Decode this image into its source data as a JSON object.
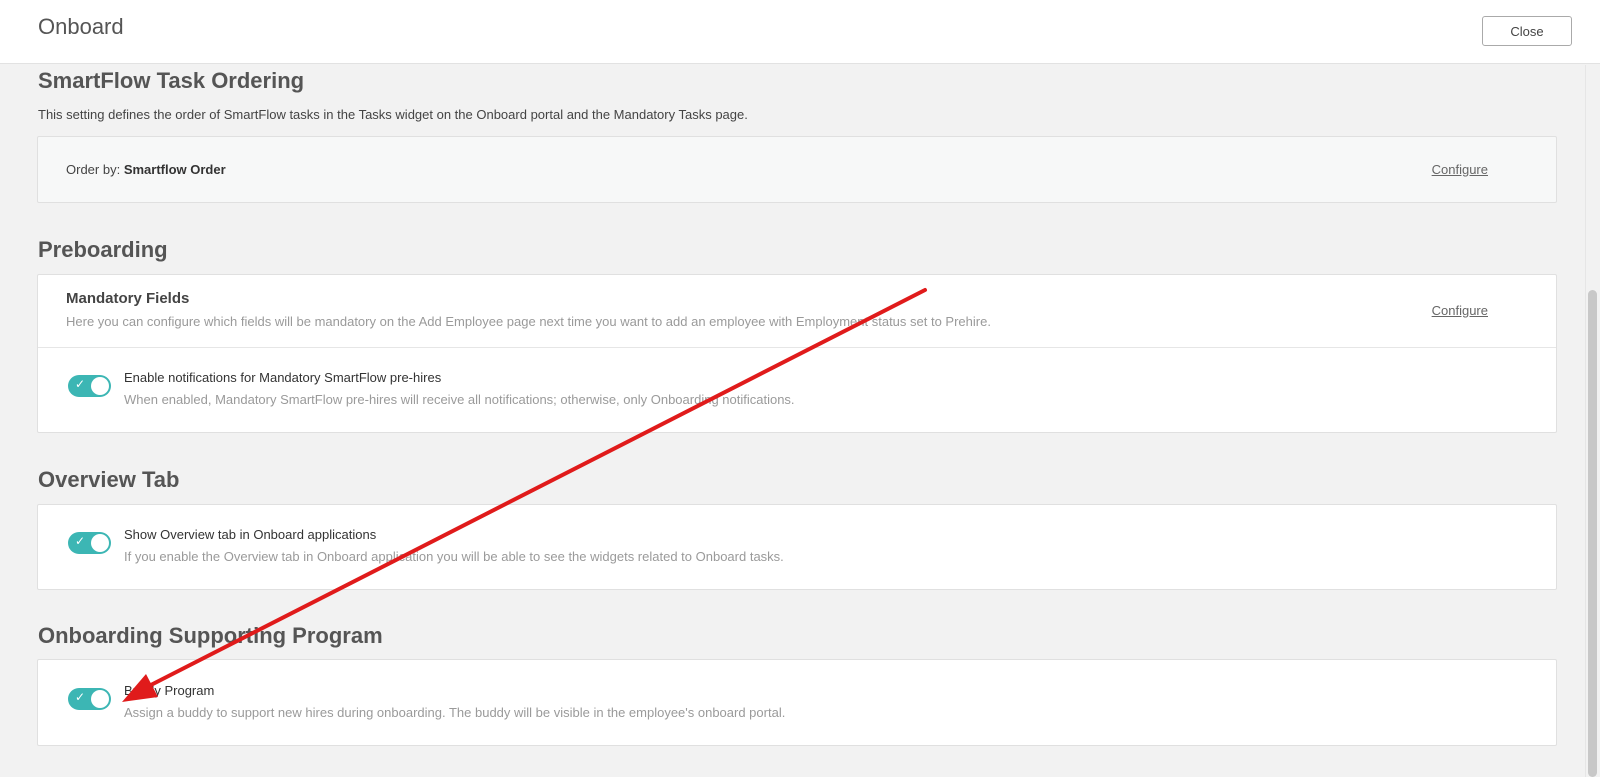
{
  "header": {
    "title": "Onboard",
    "close_label": "Close"
  },
  "task_ordering": {
    "title": "SmartFlow Task Ordering",
    "description": "This setting defines the order of SmartFlow tasks in the Tasks widget on the Onboard portal and the Mandatory Tasks page.",
    "order_label": "Order by:",
    "order_value": "Smartflow Order",
    "configure_label": "Configure"
  },
  "preboarding": {
    "title": "Preboarding",
    "mandatory_fields": {
      "title": "Mandatory Fields",
      "description": "Here you can configure which fields will be mandatory on the Add Employee page next time you want to add an employee with Employment status set to Prehire.",
      "configure_label": "Configure"
    },
    "notifications": {
      "title": "Enable notifications for Mandatory SmartFlow pre-hires",
      "description": "When enabled, Mandatory SmartFlow pre-hires will receive all notifications; otherwise, only Onboarding notifications.",
      "enabled": true
    }
  },
  "overview_tab": {
    "title": "Overview Tab",
    "option": {
      "title": "Show Overview tab in Onboard applications",
      "description": "If you enable the Overview tab in Onboard application you will be able to see the widgets related to Onboard tasks.",
      "enabled": true
    }
  },
  "supporting_program": {
    "title": "Onboarding Supporting Program",
    "buddy": {
      "title": "Buddy Program",
      "description": "Assign a buddy to support new hires during onboarding. The buddy will be visible in the employee's onboard portal.",
      "enabled": true
    }
  },
  "colors": {
    "toggle_on": "#3cb6b4",
    "annotation_arrow": "#e01b1b"
  },
  "icons": {
    "toggle_check": "check-icon"
  }
}
